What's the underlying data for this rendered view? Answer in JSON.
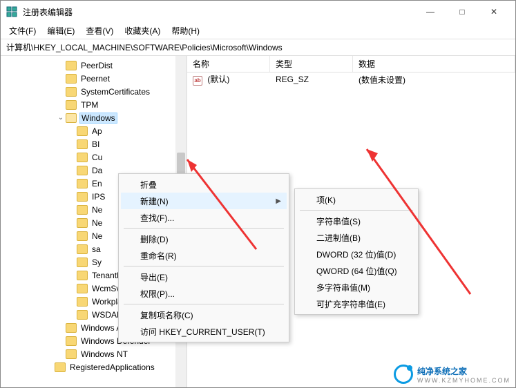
{
  "window": {
    "title": "注册表编辑器",
    "minimize": "—",
    "maximize": "□",
    "close": "✕"
  },
  "menubar": {
    "file": "文件(F)",
    "edit": "编辑(E)",
    "view": "查看(V)",
    "favorites": "收藏夹(A)",
    "help": "帮助(H)"
  },
  "pathbar": {
    "path": "计算机\\HKEY_LOCAL_MACHINE\\SOFTWARE\\Policies\\Microsoft\\Windows"
  },
  "tree": {
    "items": [
      {
        "indent": 5,
        "expander": "",
        "label": "PeerDist"
      },
      {
        "indent": 5,
        "expander": "",
        "label": "Peernet"
      },
      {
        "indent": 5,
        "expander": "",
        "label": "SystemCertificates"
      },
      {
        "indent": 5,
        "expander": "",
        "label": "TPM"
      },
      {
        "indent": 5,
        "expander": "v",
        "label": "Windows",
        "open": true,
        "selected": true
      },
      {
        "indent": 6,
        "expander": "",
        "label": "Ap"
      },
      {
        "indent": 6,
        "expander": "",
        "label": "BI"
      },
      {
        "indent": 6,
        "expander": "",
        "label": "Cu"
      },
      {
        "indent": 6,
        "expander": "",
        "label": "Da"
      },
      {
        "indent": 6,
        "expander": "",
        "label": "En"
      },
      {
        "indent": 6,
        "expander": "",
        "label": "IPS"
      },
      {
        "indent": 6,
        "expander": "",
        "label": "Ne"
      },
      {
        "indent": 6,
        "expander": "",
        "label": "Ne"
      },
      {
        "indent": 6,
        "expander": "",
        "label": "Ne"
      },
      {
        "indent": 6,
        "expander": "",
        "label": "sa"
      },
      {
        "indent": 6,
        "expander": "",
        "label": "Sy"
      },
      {
        "indent": 6,
        "expander": "",
        "label": "TenantRestrictions"
      },
      {
        "indent": 6,
        "expander": "",
        "label": "WcmSvc"
      },
      {
        "indent": 6,
        "expander": "",
        "label": "WorkplaceJoin"
      },
      {
        "indent": 6,
        "expander": "",
        "label": "WSDAPI"
      },
      {
        "indent": 5,
        "expander": "",
        "label": "Windows Advanced Th"
      },
      {
        "indent": 5,
        "expander": "",
        "label": "Windows Defender"
      },
      {
        "indent": 5,
        "expander": "",
        "label": "Windows NT"
      },
      {
        "indent": 4,
        "expander": "",
        "label": "RegisteredApplications",
        "cut": true
      }
    ]
  },
  "list": {
    "headers": {
      "name": "名称",
      "type": "类型",
      "data": "数据"
    },
    "rows": [
      {
        "icon": "ab",
        "name": "(默认)",
        "type": "REG_SZ",
        "data": "(数值未设置)"
      }
    ]
  },
  "context_menu1": {
    "items": [
      {
        "label": "折叠"
      },
      {
        "label": "新建(N)",
        "submenu": true,
        "highlight": true
      },
      {
        "label": "查找(F)..."
      },
      {
        "sep": true
      },
      {
        "label": "删除(D)"
      },
      {
        "label": "重命名(R)"
      },
      {
        "sep": true
      },
      {
        "label": "导出(E)"
      },
      {
        "label": "权限(P)..."
      },
      {
        "sep": true
      },
      {
        "label": "复制项名称(C)"
      },
      {
        "label": "访问 HKEY_CURRENT_USER(T)"
      }
    ]
  },
  "context_menu2": {
    "items": [
      {
        "label": "项(K)"
      },
      {
        "sep": true
      },
      {
        "label": "字符串值(S)"
      },
      {
        "label": "二进制值(B)"
      },
      {
        "label": "DWORD (32 位)值(D)"
      },
      {
        "label": "QWORD (64 位)值(Q)"
      },
      {
        "label": "多字符串值(M)"
      },
      {
        "label": "可扩充字符串值(E)"
      }
    ]
  },
  "watermark": {
    "text": "纯净系统之家",
    "sub": "WWW.KZMYHOME.COM"
  }
}
